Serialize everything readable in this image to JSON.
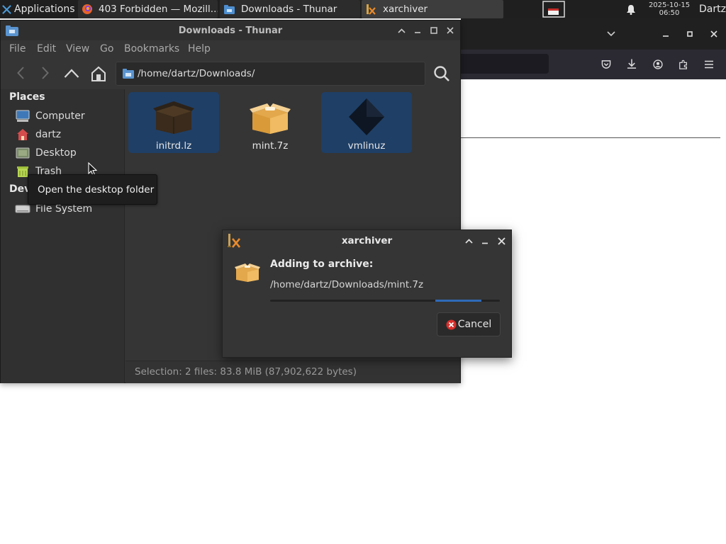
{
  "panel": {
    "applications_label": "Applications",
    "tasks": [
      {
        "label": "403 Forbidden — Mozill...",
        "icon": "firefox-icon",
        "active": false
      },
      {
        "label": "Downloads - Thunar",
        "icon": "folder-icon",
        "active": false
      },
      {
        "label": "xarchiver",
        "icon": "xarchiver-icon",
        "active": true
      }
    ],
    "date": "2025-10-15",
    "time": "06:50",
    "user": "Dartz"
  },
  "thunar": {
    "title": "Downloads - Thunar",
    "menu": [
      "File",
      "Edit",
      "View",
      "Go",
      "Bookmarks",
      "Help"
    ],
    "location": "/home/dartz/Downloads/",
    "places_header": "Places",
    "places": [
      {
        "label": "Computer",
        "icon": "computer-icon"
      },
      {
        "label": "dartz",
        "icon": "home-icon"
      },
      {
        "label": "Desktop",
        "icon": "desktop-icon"
      },
      {
        "label": "Trash",
        "icon": "trash-icon"
      }
    ],
    "devices_header": "Devi",
    "devices": [
      {
        "label": "File System",
        "icon": "drive-icon"
      }
    ],
    "files": [
      {
        "name": "initrd.lz",
        "icon": "archive-dark-icon",
        "selected": true
      },
      {
        "name": "mint.7z",
        "icon": "archive-icon",
        "selected": false
      },
      {
        "name": "vmlinuz",
        "icon": "binary-file-icon",
        "selected": true
      }
    ],
    "status": "Selection: 2 files: 83.8 MiB (87,902,622 bytes)"
  },
  "tooltip": {
    "text": "Open the desktop folder"
  },
  "xarchiver": {
    "title": "xarchiver",
    "heading": "Adding to archive:",
    "path": "/home/dartz/Downloads/mint.7z",
    "progress": 0.2,
    "cancel_label": "Cancel"
  },
  "colors": {
    "selection": "#1f3f66",
    "progress": "#2f6ab8",
    "panel": "#1f1f1f"
  }
}
